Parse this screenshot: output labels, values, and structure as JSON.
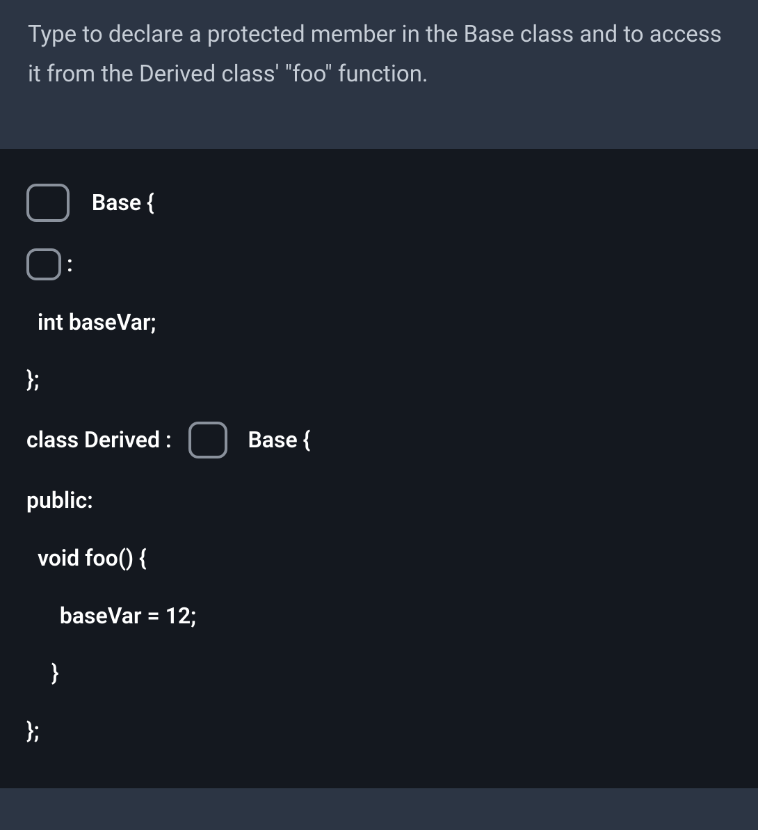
{
  "prompt": "Type to declare a protected member in the Base class and to access it from the Derived class' \"foo\" function.",
  "code": {
    "line1_suffix": "  Base {",
    "line2_suffix": ":",
    "line3": " int baseVar;",
    "line4": "};",
    "line5_prefix": "class Derived :  ",
    "line5_suffix": "  Base {",
    "line6": "public:",
    "line7": " void foo() {",
    "line8": "   baseVar = 12;",
    "line9": "  }",
    "line10": "};"
  }
}
